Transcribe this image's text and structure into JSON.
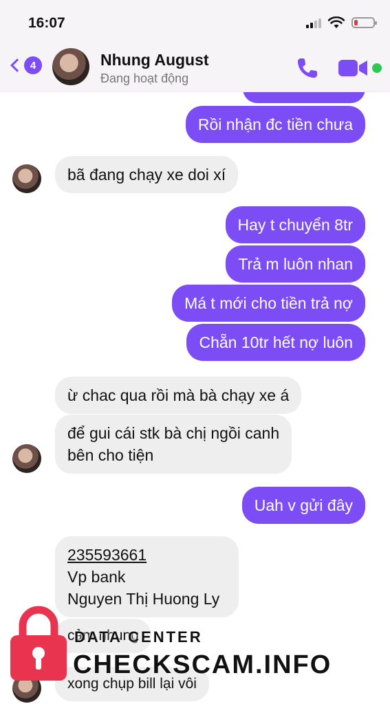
{
  "status_bar": {
    "time": "16:07"
  },
  "header": {
    "back_badge": "4",
    "contact_name": "Nhung August",
    "contact_status": "Đang hoạt động",
    "accent_color": "#7b4df2"
  },
  "messages": [
    {
      "side": "out",
      "text": "Rồi nhận đc tiền chưa"
    },
    {
      "side": "in",
      "text": "bã đang chạy xe doi xí"
    },
    {
      "side": "out",
      "text": "Hay t chuyển 8tr"
    },
    {
      "side": "out",
      "text": "Trả m luôn nhan"
    },
    {
      "side": "out",
      "text": "Má t mới cho tiền trả nợ"
    },
    {
      "side": "out",
      "text": "Chẵn 10tr hết nợ luôn"
    },
    {
      "side": "in",
      "text": "ừ chac qua rồi mà bà chạy xe á"
    },
    {
      "side": "in",
      "lines": [
        "để gui cái stk bà chị ngồi canh",
        "bên cho tiện"
      ]
    },
    {
      "side": "out",
      "text": "Uah v gửi đây"
    },
    {
      "side": "in",
      "lines": [
        "235593661",
        "Vp bank",
        "Nguyen Thị Huong Ly"
      ]
    },
    {
      "side": "in",
      "text": "cảm nhung"
    },
    {
      "side": "in",
      "text": "xong chụp bill lại vôi"
    }
  ],
  "watermark": {
    "line1": "DATA CENTER",
    "line2": "CHECKSCAM.INFO",
    "icon": "padlock-icon",
    "icon_color": "#e8344e"
  }
}
